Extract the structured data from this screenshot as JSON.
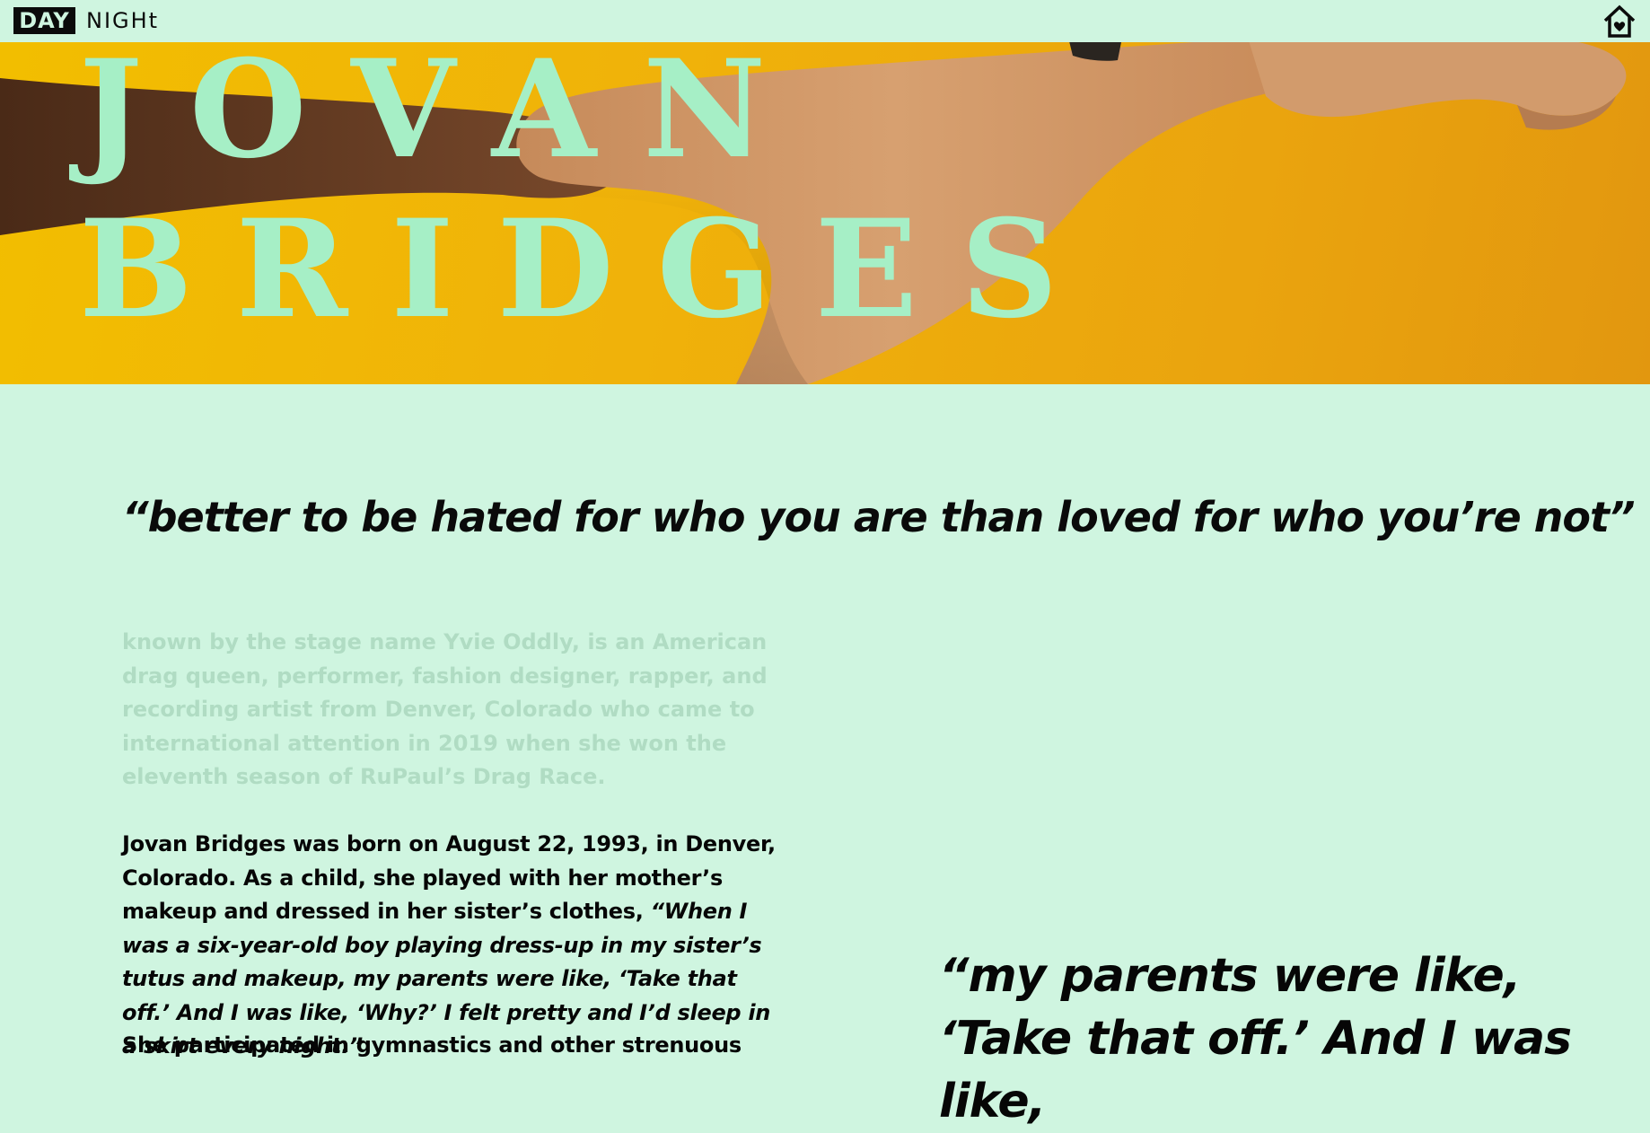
{
  "nav": {
    "day_label": "DAY",
    "night_label": "NIGHt",
    "home_icon": "home-heart-icon"
  },
  "hero": {
    "first_name": "JOVAN",
    "last_name": "BRIDGES",
    "background_color": "#f0b20a",
    "title_color": "#a6efc6"
  },
  "content": {
    "main_quote": "“better to be hated for who you are than loved for who you’re not”",
    "intro": "known by the stage name Yvie Oddly, is an American drag queen, performer, fashion designer, rapper, and recording artist from Denver, Colorado who came to international attention in 2019 when she won the eleventh season of RuPaul’s Drag Race.",
    "bio_plain": "Jovan Bridges was born on August 22, 1993, in Denver, Colorado. As a child, she played with her mother’s makeup and dressed in her sister’s clothes, ",
    "bio_quote": "“When I was a six-year-old boy playing dress-up in my sister’s tutus and makeup, my parents were like, ‘Take that off.’ And I was like, ‘Why?’ I felt pretty and I’d sleep in a skirt every night.”",
    "bio_next": "She participated in gymnastics and other strenuous",
    "side_quote": "“my parents were like, ‘Take that off.’ And I was like,"
  },
  "colors": {
    "page_background": "#cff5e0",
    "muted_text": "#b0dcc3",
    "text": "#060606"
  }
}
